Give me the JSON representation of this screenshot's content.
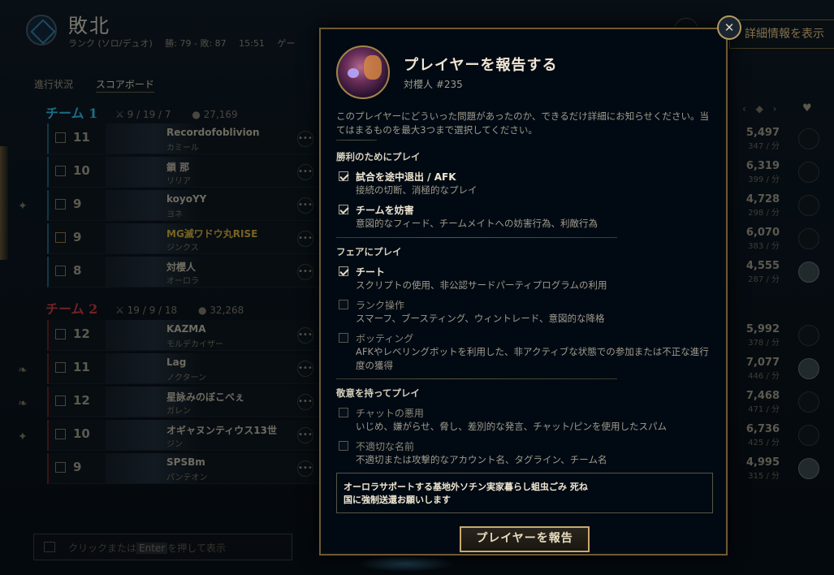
{
  "header": {
    "result": "敗北",
    "queue": "ランク (ソロ/デュオ)",
    "record": "勝: 79 - 敗: 87",
    "duration": "15:51",
    "truncated": "ゲー",
    "details_button": "詳細情報を表示",
    "close_glyph": "✕"
  },
  "tabs": [
    {
      "label": "進行状況"
    },
    {
      "label": "スコアボード"
    }
  ],
  "teams": [
    {
      "name": "チーム 1",
      "kda": "9 / 19 / 7",
      "gold": "27,169",
      "players": [
        {
          "level": "11",
          "summoner": "Recordofoblivion",
          "champion": "カミール",
          "gold": "5,497",
          "gpm": "347 / 分"
        },
        {
          "level": "10",
          "summoner": "鎖 那",
          "champion": "リリア",
          "gold": "6,319",
          "gpm": "399 / 分"
        },
        {
          "level": "9",
          "summoner": "koyoYY",
          "champion": "ヨネ",
          "gold": "4,728",
          "gpm": "298 / 分"
        },
        {
          "level": "9",
          "summoner": "MG滅ワドウ丸RISE",
          "champion": "ジンクス",
          "gold": "6,070",
          "gpm": "383 / 分"
        },
        {
          "level": "8",
          "summoner": "対櫻人",
          "champion": "オーロラ",
          "gold": "4,555",
          "gpm": "287 / 分"
        }
      ]
    },
    {
      "name": "チーム 2",
      "kda": "19 / 9 / 18",
      "gold": "32,268",
      "players": [
        {
          "level": "12",
          "summoner": "KAZMA",
          "champion": "モルデカイザー",
          "gold": "5,992",
          "gpm": "378 / 分"
        },
        {
          "level": "11",
          "summoner": "Lag",
          "champion": "ノクターン",
          "gold": "7,077",
          "gpm": "446 / 分"
        },
        {
          "level": "12",
          "summoner": "星詠みのぼこべぇ",
          "champion": "ガレン",
          "gold": "7,468",
          "gpm": "471 / 分"
        },
        {
          "level": "10",
          "summoner": "オギャヌンティウス13世",
          "champion": "ジン",
          "gold": "6,736",
          "gpm": "425 / 分"
        },
        {
          "level": "9",
          "summoner": "SPSBm",
          "champion": "パンテオン",
          "gold": "4,995",
          "gpm": "315 / 分"
        }
      ]
    }
  ],
  "right_header": "‹ ◆ ›",
  "more_glyph": "•••",
  "chat": {
    "prefix": "クリックまたは",
    "key": "Enter",
    "suffix": "を押して表示"
  },
  "modal": {
    "title": "プレイヤーを報告する",
    "subtitle": "対櫻人 #235",
    "description": "このプレイヤーにどういった問題があったのか、できるだけ詳細にお知らせください。当てはまるものを最大3つまで選択してください。",
    "sections": [
      {
        "title": "勝利のためにプレイ",
        "options": [
          {
            "label": "試合を途中退出 / AFK",
            "desc": "接続の切断、消極的なプレイ",
            "checked": true
          },
          {
            "label": "チームを妨害",
            "desc": "意図的なフィード、チームメイトへの妨害行為、利敵行為",
            "checked": true
          }
        ]
      },
      {
        "title": "フェアにプレイ",
        "options": [
          {
            "label": "チート",
            "desc": "スクリプトの使用、非公認サードパーティプログラムの利用",
            "checked": true
          },
          {
            "label": "ランク操作",
            "desc": "スマーフ、ブースティング、ウィントレード、意図的な降格",
            "checked": false
          },
          {
            "label": "ボッティング",
            "desc": "AFKやレベリングボットを利用した、非アクティブな状態での参加または不正な進行度の獲得",
            "checked": false
          }
        ]
      },
      {
        "title": "敬意を持ってプレイ",
        "options": [
          {
            "label": "チャットの悪用",
            "desc": "いじめ、嫌がらせ、脅し、差別的な発言、チャット/ピンを使用したスパム",
            "checked": false
          },
          {
            "label": "不適切な名前",
            "desc": "不適切または攻撃的なアカウント名、タグライン、チーム名",
            "checked": false
          }
        ]
      }
    ],
    "comment": "オーロラサポートする基地外ソチン実家暮らし蛆虫ごみ 死ね\n国に強制送還お願いします",
    "submit": "プレイヤーを報告"
  }
}
